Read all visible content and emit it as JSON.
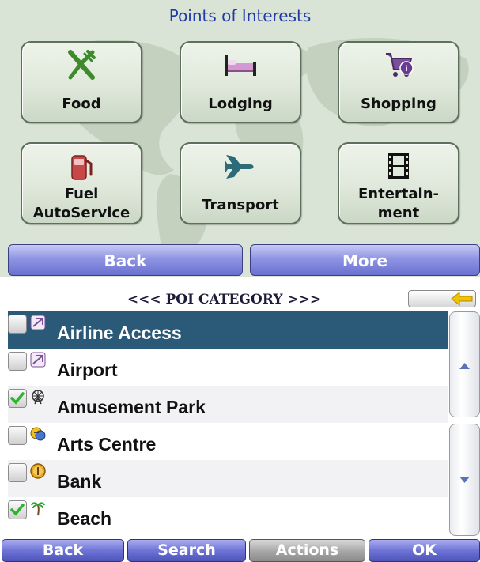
{
  "top_panel": {
    "title": "Points of Interests",
    "tiles": [
      {
        "label": "Food",
        "icon": "fork-knife-icon"
      },
      {
        "label": "Lodging",
        "icon": "bed-icon"
      },
      {
        "label": "Shopping",
        "icon": "shopping-cart-icon"
      },
      {
        "label": "Fuel\nAutoService",
        "label_line1": "Fuel",
        "label_line2": "AutoService",
        "icon": "fuel-pump-icon"
      },
      {
        "label": "Transport",
        "icon": "airplane-icon"
      },
      {
        "label": "Entertainment",
        "label_line1": "Entertain-",
        "label_line2": "ment",
        "icon": "film-strip-icon"
      }
    ],
    "back_label": "Back",
    "more_label": "More"
  },
  "poi_list": {
    "header": "<<< POI CATEGORY >>>",
    "items": [
      {
        "name": "Airline Access",
        "checked": false,
        "selected": true,
        "icon": "airline-icon"
      },
      {
        "name": "Airport",
        "checked": false,
        "selected": false,
        "icon": "airport-icon"
      },
      {
        "name": "Amusement Park",
        "checked": true,
        "selected": false,
        "icon": "ferris-wheel-icon"
      },
      {
        "name": "Arts Centre",
        "checked": false,
        "selected": false,
        "icon": "theater-masks-icon"
      },
      {
        "name": "Bank",
        "checked": false,
        "selected": false,
        "icon": "coin-icon"
      },
      {
        "name": "Beach",
        "checked": true,
        "selected": false,
        "icon": "palm-tree-icon"
      }
    ],
    "buttons": {
      "back": "Back",
      "search": "Search",
      "actions": "Actions",
      "ok": "OK"
    }
  },
  "colors": {
    "title_blue": "#1f3aa8",
    "selected_row": "#2a5a78",
    "button_blue": "#6e74d6",
    "arrow_yellow": "#f2c200",
    "check_green": "#2fb32f"
  }
}
